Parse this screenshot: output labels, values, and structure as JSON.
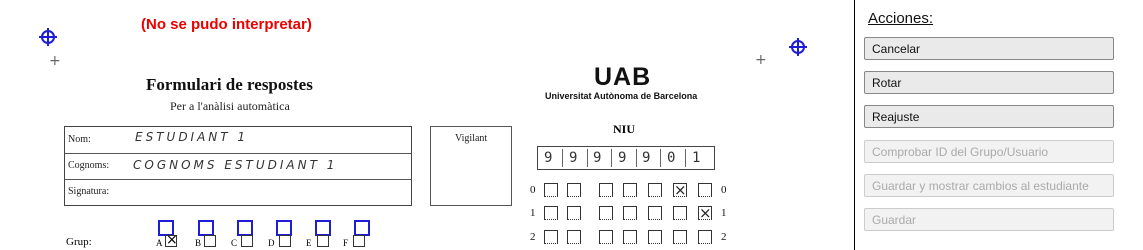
{
  "viewer": {
    "status_message": "(No se pudo interpretar)",
    "form": {
      "title": "Formulari de respostes",
      "subtitle": "Per a l'anàlisi automàtica",
      "logo_text": "UAB",
      "university": "Universitat Autònoma de Barcelona",
      "fields": [
        {
          "label": "Nom:",
          "handwritten": "ESTUDIANT 1"
        },
        {
          "label": "Cognoms:",
          "handwritten": "COGNOMS ESTUDIANT 1"
        },
        {
          "label": "Signatura:",
          "handwritten": ""
        }
      ],
      "vigilant_label": "Vigilant",
      "niu_label": "NIU",
      "niu_digits": [
        "9",
        "9",
        "9",
        "9",
        "9",
        "0",
        "1"
      ],
      "bubble_rows": [
        "0",
        "1",
        "2"
      ],
      "group_label": "Grup:",
      "group_options": [
        "A",
        "B",
        "C",
        "D",
        "E",
        "F"
      ],
      "group_selected": "A"
    }
  },
  "panel": {
    "title": "Acciones:",
    "buttons": [
      {
        "label": "Cancelar",
        "enabled": true
      },
      {
        "label": "Rotar",
        "enabled": true
      },
      {
        "label": "Reajuste",
        "enabled": true
      },
      {
        "label": "Comprobar ID del Grupo/Usuario",
        "enabled": false
      },
      {
        "label": "Guardar y mostrar cambios al estudiante",
        "enabled": false
      },
      {
        "label": "Guardar",
        "enabled": false
      }
    ]
  }
}
